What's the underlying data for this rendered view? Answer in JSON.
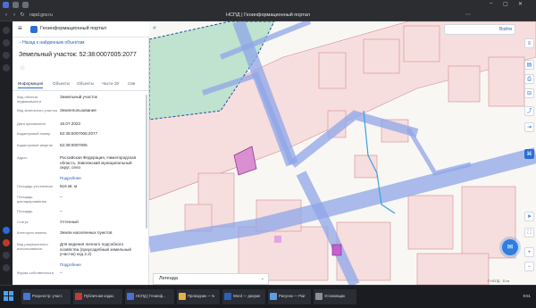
{
  "browser": {
    "url": "nspd.gov.ru",
    "title": "НСПД | Геоинформационный портал"
  },
  "app": {
    "header_name": "Геоинформационный портал",
    "back_link": "Назад к найденным объектам",
    "object_title": "Земельный участок: 52:38:0007005:2077",
    "tabs": [
      "Информация",
      "Объекты",
      "Объекты",
      "Части ЗУ",
      "Свя"
    ],
    "rows": [
      {
        "k": "Вид объекта недвижимости",
        "v": "Земельный участок"
      },
      {
        "k": "Вид земельного участка",
        "v": "Землепользование"
      },
      {
        "k": "Дата присвоения",
        "v": "16.07.2023"
      },
      {
        "k": "Кадастровый номер",
        "v": "52:38:0007005:2077"
      },
      {
        "k": "Кадастровый квартал",
        "v": "52:38:0007005"
      },
      {
        "k": "Адрес",
        "v": "Российская Федерация, Нижегородская область, Заволжский муниципальный округ, село",
        "more": "Подробнее"
      },
      {
        "k": "Площадь уточненная",
        "v": "516 кв. м"
      },
      {
        "k": "Площадь декларированная",
        "v": "–"
      },
      {
        "k": "Площадь",
        "v": "–"
      },
      {
        "k": "Статус",
        "v": "Учтенный"
      },
      {
        "k": "Категория земель",
        "v": "Земли населенных пунктов"
      },
      {
        "k": "Вид разрешенного использования",
        "v": "Для ведения личного подсобного хозяйства (приусадебный земельный участок) код 2.2)",
        "more": "Подробнее"
      },
      {
        "k": "Форма собственности",
        "v": "–"
      }
    ]
  },
  "map": {
    "search_label": "Войти",
    "legend_label": "Легенда",
    "scale_text": "© НСПД · 10 м"
  },
  "taskbar": {
    "items": [
      "Росреестр: участ...",
      "Публичная кадас...",
      "НСПД | Геоинф...",
      "Проводник — Мой...",
      "Word — документ",
      "Рисунок — Paint",
      "Установщик"
    ],
    "clock": "9:51"
  },
  "colors": {
    "accent": "#2b6fd6",
    "parcel_highlight": "#d98fd2",
    "forest": "#bfe3cf",
    "roads_overlay": "#8fa6e8"
  }
}
